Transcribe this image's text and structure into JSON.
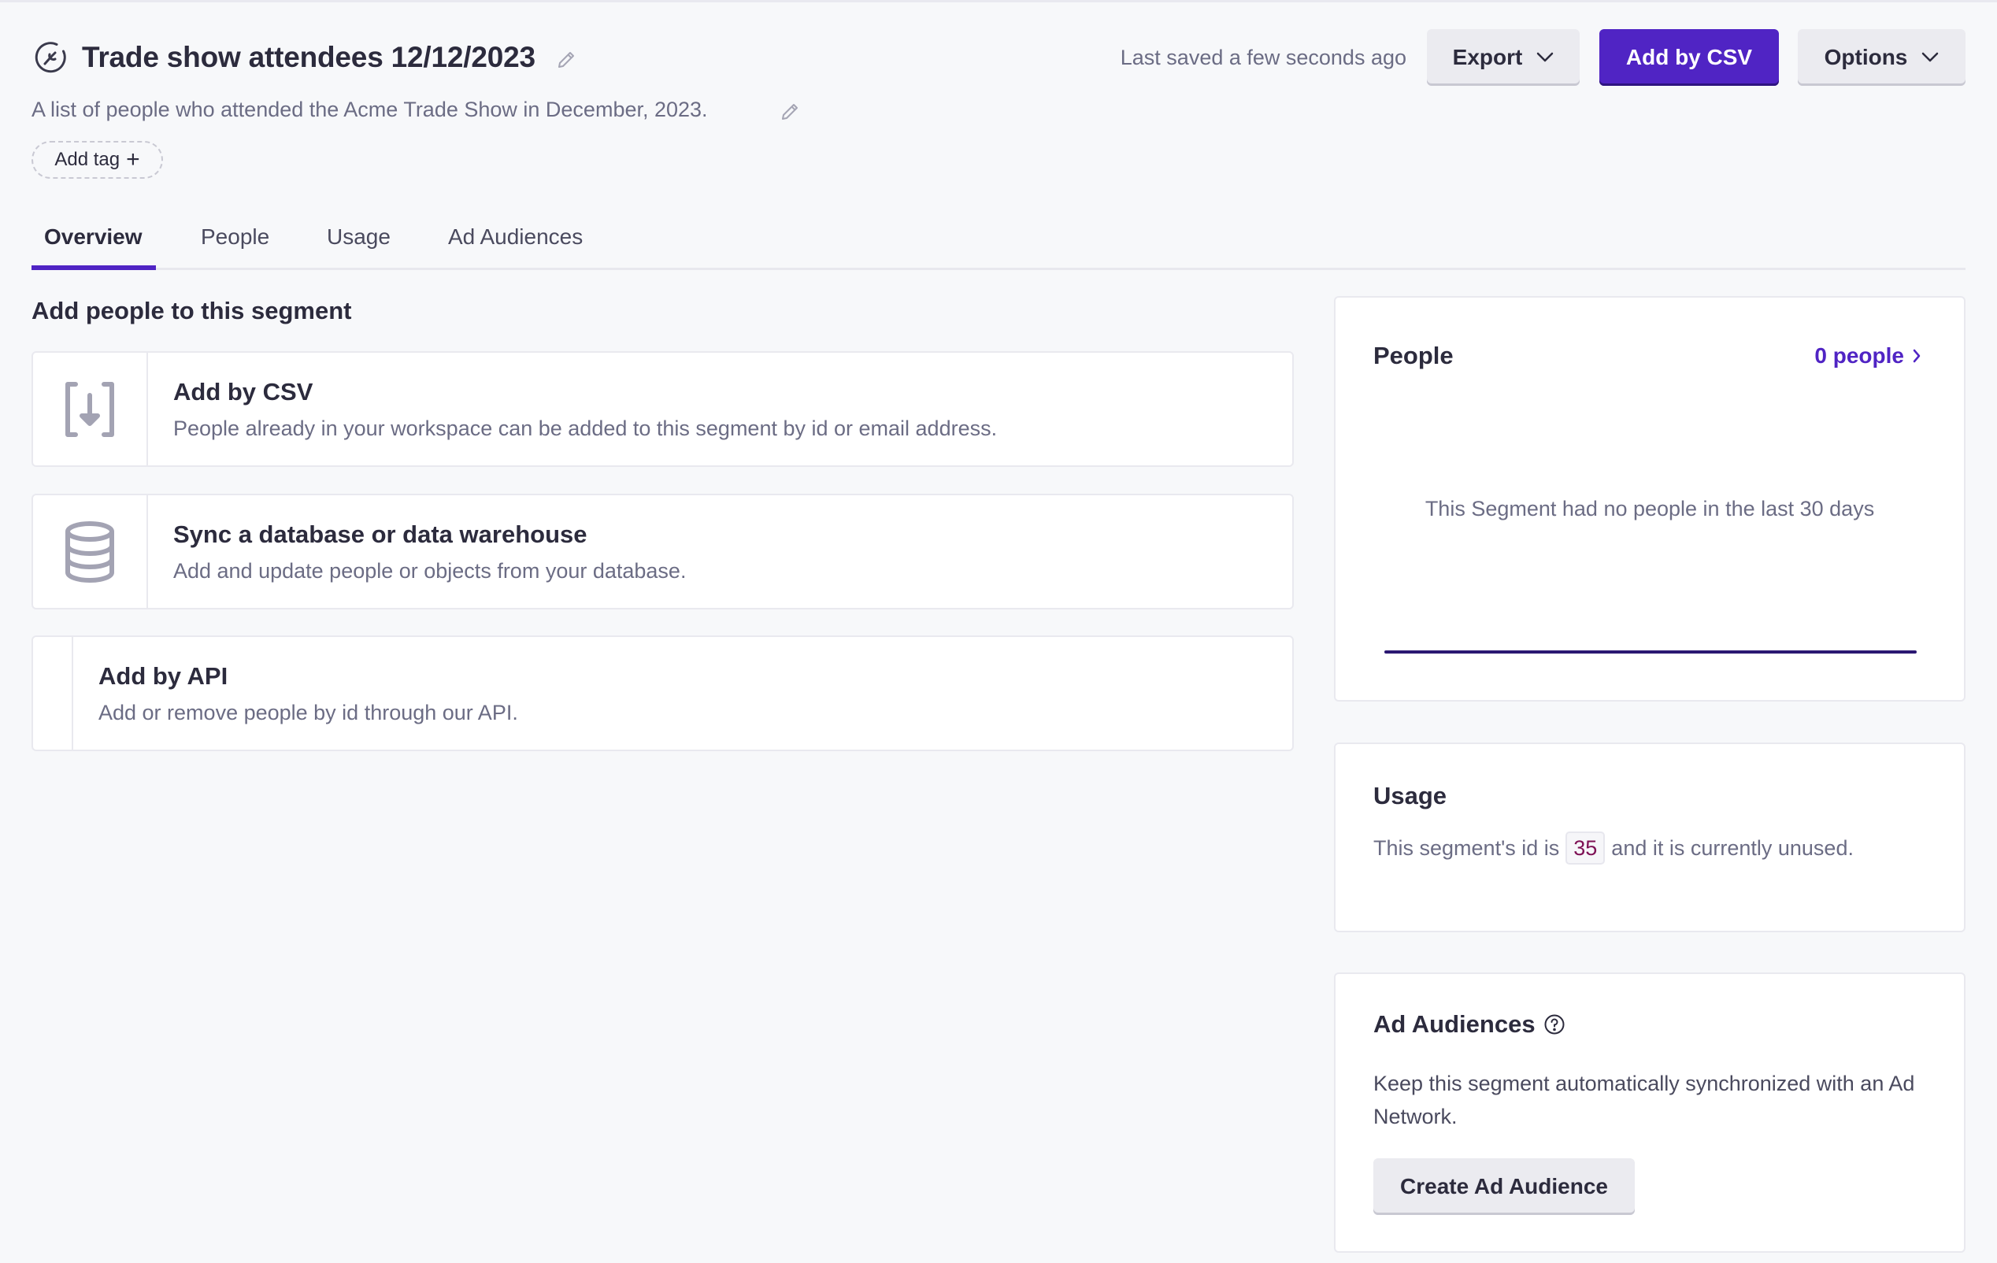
{
  "header": {
    "title": "Trade show attendees 12/12/2023",
    "title_icon": "segment-wrench-icon",
    "description": "A list of people who attended the Acme Trade Show in December, 2023.",
    "add_tag_label": "Add tag",
    "last_saved": "Last saved a few seconds ago",
    "buttons": {
      "export": "Export",
      "add_by_csv": "Add by CSV",
      "options": "Options"
    }
  },
  "tabs": [
    {
      "label": "Overview",
      "active": true
    },
    {
      "label": "People",
      "active": false
    },
    {
      "label": "Usage",
      "active": false
    },
    {
      "label": "Ad Audiences",
      "active": false
    }
  ],
  "add_people": {
    "heading": "Add people to this segment",
    "cards": [
      {
        "icon": "csv-import-icon",
        "title": "Add by CSV",
        "description": "People already in your workspace can be added to this segment by id or email address."
      },
      {
        "icon": "database-icon",
        "title": "Sync a database or data warehouse",
        "description": "Add and update people or objects from your database."
      },
      {
        "icon": "",
        "title": "Add by API",
        "description": "Add or remove people by id through our API."
      }
    ]
  },
  "people_panel": {
    "title": "People",
    "link_label": "0 people",
    "empty_message": "This Segment had no people in the last 30 days",
    "chart_color": "#2b1872"
  },
  "usage_panel": {
    "title": "Usage",
    "text_before": "This segment's id is",
    "segment_id": "35",
    "text_after": "and it is currently unused."
  },
  "ad_panel": {
    "title": "Ad Audiences",
    "description": "Keep this segment automatically synchronized with an Ad Network.",
    "button_label": "Create Ad Audience"
  },
  "colors": {
    "accent": "#5024c4",
    "background": "#f7f8fa",
    "segment_id_text": "#7e1155"
  }
}
